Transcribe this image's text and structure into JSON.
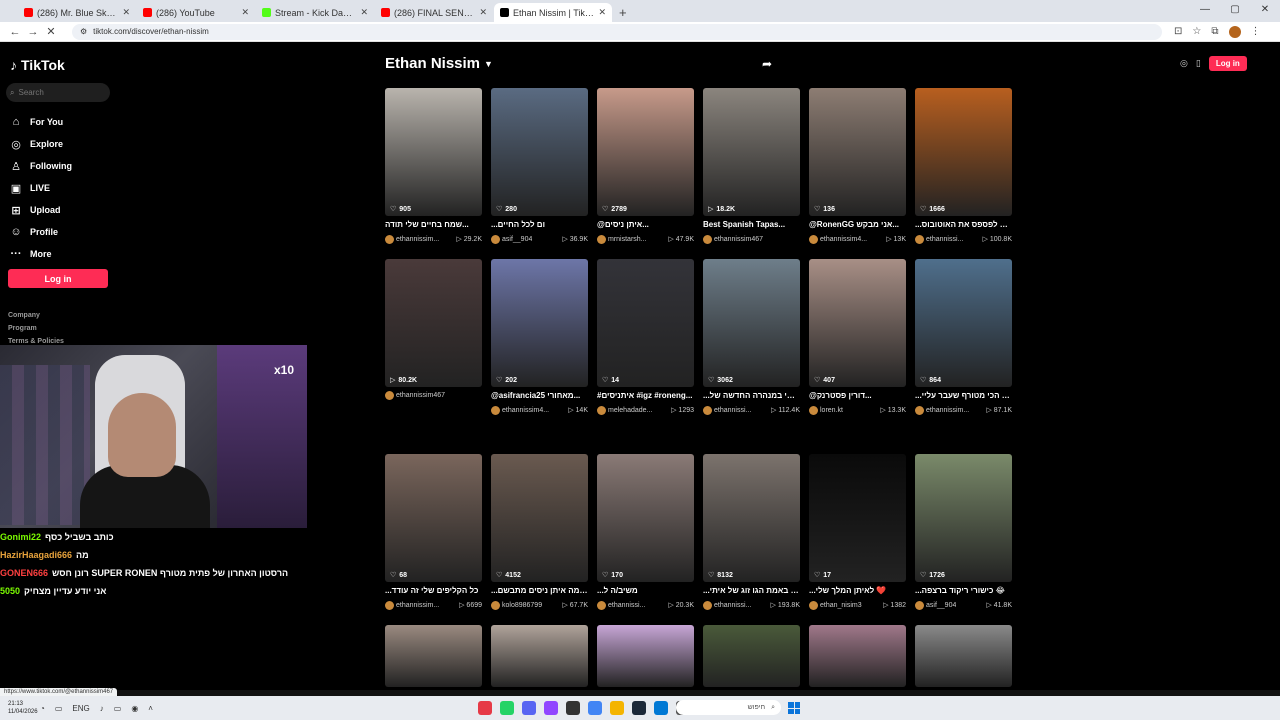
{
  "browser": {
    "tabs": [
      {
        "title": "(286) Mr. Blue Sky - YouTube",
        "color": "#ff0000",
        "active": false
      },
      {
        "title": "(286) YouTube",
        "color": "#ff0000",
        "active": false
      },
      {
        "title": "Stream - Kick Dashboard",
        "color": "#53fc18",
        "active": false
      },
      {
        "title": "(286) FINAL SENTENCE GAME",
        "color": "#ff0000",
        "active": false
      },
      {
        "title": "Ethan Nissim | TikTok",
        "color": "#000000",
        "active": true
      }
    ],
    "url": "tiktok.com/discover/ethan-nissim",
    "status_url": "https://www.tiktok.com/@ethannissim467"
  },
  "sidebar": {
    "logo": "TikTok",
    "search_placeholder": "Search",
    "menu": [
      {
        "label": "For You",
        "icon": "home-icon",
        "glyph": "⌂"
      },
      {
        "label": "Explore",
        "icon": "compass-icon",
        "glyph": "◎"
      },
      {
        "label": "Following",
        "icon": "person-icon",
        "glyph": "♙"
      },
      {
        "label": "LIVE",
        "icon": "live-icon",
        "glyph": "▣"
      },
      {
        "label": "Upload",
        "icon": "upload-icon",
        "glyph": "⊞"
      },
      {
        "label": "Profile",
        "icon": "profile-icon",
        "glyph": "☺"
      },
      {
        "label": "More",
        "icon": "more-icon",
        "glyph": "···"
      }
    ],
    "login_label": "Log in",
    "footer_links": [
      "Company",
      "Program",
      "Terms & Policies"
    ]
  },
  "header": {
    "title": "Ethan Nissim",
    "login_label": "Log in"
  },
  "videos": [
    {
      "stat": "905",
      "stat_icon": "heart",
      "caption": "שמח בחיים שלי תודה...",
      "user": "ethannissim...",
      "views": "29.2K",
      "bg": "#b9b4ad"
    },
    {
      "stat": "280",
      "stat_icon": "heart",
      "caption": "...ום לכל החיים",
      "user": "asif__904",
      "views": "36.9K",
      "bg": "#5a6b82"
    },
    {
      "stat": "2789",
      "stat_icon": "heart",
      "caption": "@איתן ניסים...",
      "user": "mrnistarsh...",
      "views": "47.9K",
      "bg": "#c79a8a"
    },
    {
      "stat": "18.2K",
      "stat_icon": "play",
      "caption": "Best Spanish Tapas...",
      "user": "ethannissim467",
      "views": "",
      "bg": "#8b857e"
    },
    {
      "stat": "136",
      "stat_icon": "heart",
      "caption": "@RonenGG אני מבקש...",
      "user": "ethannissim4...",
      "views": "13K",
      "bg": "#8d7d73"
    },
    {
      "stat": "1666",
      "stat_icon": "heart",
      "caption": "...בלחץ לפספס את האוטובוס",
      "user": "ethannissi...",
      "views": "100.8K",
      "bg": "#b85f1f"
    },
    {
      "stat": "80.2K",
      "stat_icon": "play",
      "caption": "",
      "user": "ethannissim467",
      "views": "",
      "bg": "#4a3a3a"
    },
    {
      "stat": "202",
      "stat_icon": "heart",
      "caption": "@asifrancia25 מאחורי...",
      "user": "ethannissim4...",
      "views": "14K",
      "bg": "#6d76a8"
    },
    {
      "stat": "14",
      "stat_icon": "heart",
      "caption": "#איתניסים #igz #roneng...",
      "user": "melehadade...",
      "views": "1293",
      "bg": "#333339"
    },
    {
      "stat": "3062",
      "stat_icon": "heart",
      "caption": "...נסעתי במנהרה החדשה של",
      "user": "ethannissi...",
      "views": "112.4K",
      "bg": "#6e7e8a"
    },
    {
      "stat": "407",
      "stat_icon": "heart",
      "caption": "@דורין פסטרנק...",
      "user": "loren.kt",
      "views": "13.3K",
      "bg": "#a88f86"
    },
    {
      "stat": "864",
      "stat_icon": "heart",
      "caption": "...יום הכי מטורף שעבר עליי",
      "user": "ethannissim...",
      "views": "87.1K",
      "bg": "#4f6f8c"
    },
    {
      "stat": "68",
      "stat_icon": "heart",
      "caption": "...כל הקליפים שלי זה עודד",
      "user": "ethannissim...",
      "views": "6699",
      "bg": "#7a665c"
    },
    {
      "stat": "4152",
      "stat_icon": "heart",
      "caption": "...עם מה איתן ניסים מתבשם",
      "user": "kolo8986799",
      "views": "67.7K",
      "bg": "#6a5a50"
    },
    {
      "stat": "170",
      "stat_icon": "heart",
      "caption": "...משיב/ה ל",
      "user": "ethannissi...",
      "views": "20.3K",
      "bg": "#8a7a76"
    },
    {
      "stat": "8132",
      "stat_icon": "heart",
      "caption": "...איי לא באמת הגו זוג של איתי",
      "user": "ethannissi...",
      "views": "193.8K",
      "bg": "#7c736d"
    },
    {
      "stat": "17",
      "stat_icon": "heart",
      "caption": "...לאיתן המלך שלי ❤️",
      "user": "ethan_nisim3",
      "views": "1382",
      "bg": "#0a0a0a"
    },
    {
      "stat": "1726",
      "stat_icon": "heart",
      "caption": "...כישורי ריקוד ברצפה 😂",
      "user": "asif__904",
      "views": "41.8K",
      "bg": "#7a8a6a"
    },
    {
      "stat": "",
      "stat_icon": "",
      "caption": "",
      "user": "",
      "views": "",
      "bg": "#9a8a80"
    },
    {
      "stat": "",
      "stat_icon": "",
      "caption": "",
      "user": "",
      "views": "",
      "bg": "#b0a39a"
    },
    {
      "stat": "",
      "stat_icon": "",
      "caption": "",
      "user": "",
      "views": "",
      "bg": "#c7a6d6"
    },
    {
      "stat": "",
      "stat_icon": "",
      "caption": "",
      "user": "",
      "views": "",
      "bg": "#4a5a3a"
    },
    {
      "stat": "",
      "stat_icon": "",
      "caption": "",
      "user": "",
      "views": "",
      "bg": "#a0788a"
    },
    {
      "stat": "",
      "stat_icon": "",
      "caption": "",
      "user": "",
      "views": "",
      "bg": "#8a8a8a"
    }
  ],
  "webcam": {
    "multiplier": "x10"
  },
  "chat": [
    {
      "name": "Gonimi22",
      "name_color": "#7cfc00",
      "text": "כותב בשביל כסף"
    },
    {
      "name": "HazirHaagadi666",
      "name_color": "#e8a33c",
      "text": "מה"
    },
    {
      "name": "GONEN666",
      "name_color": "#ff4040",
      "text": "רונן חסש SUPER RONEN הרסטון האחרון של פתית מטורף"
    },
    {
      "name": "5050",
      "name_color": "#7cfc00",
      "text": "אני יודע עדיין מצחיק"
    }
  ],
  "taskbar": {
    "time": "21:13",
    "date": "11/04/2026",
    "lang": "ENG",
    "search_text": "חיפוש"
  }
}
